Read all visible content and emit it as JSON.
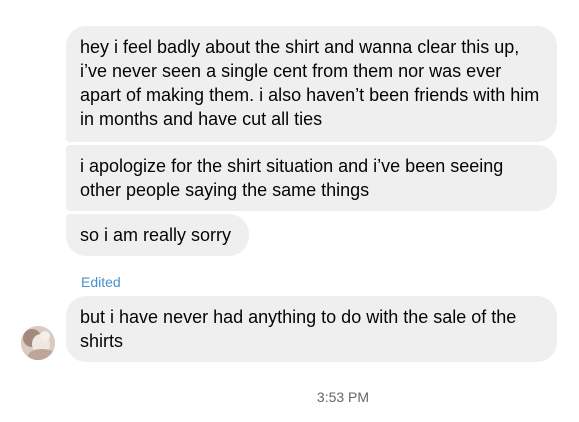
{
  "conversation": {
    "messages": [
      {
        "text": "hey i feel badly about the shirt and wanna clear this up, i’ve never seen a single cent from them nor was ever apart of making them. i also haven’t been friends with him in months and have cut all ties"
      },
      {
        "text": "i apologize for the shirt situation and i’ve been seeing other people saying the same things"
      },
      {
        "text": "so i am really sorry"
      },
      {
        "text": "but i have never had anything to do with the sale of the shirts"
      }
    ],
    "edited_label": "Edited",
    "timestamp": "3:53 PM"
  },
  "colors": {
    "bubble_background": "#efefef",
    "edited_label": "#4a90c9",
    "timestamp": "#65676b"
  },
  "icons": {
    "avatar": "sender-avatar-photo"
  }
}
